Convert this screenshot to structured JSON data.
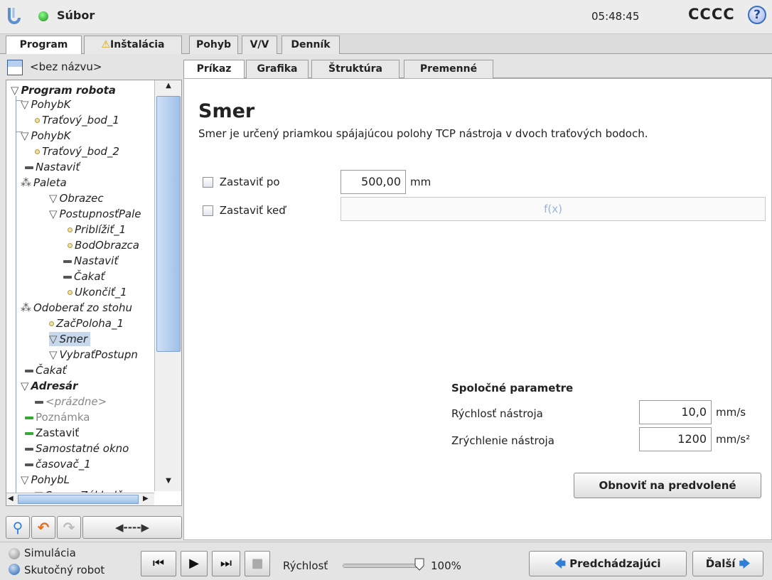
{
  "header": {
    "menu_label": "Súbor",
    "time": "05:48:45",
    "robot_name": "CCCC",
    "help_icon": "help-icon"
  },
  "main_tabs": [
    "Program",
    "Inštalácia",
    "Pohyb",
    "V/V",
    "Denník"
  ],
  "program_name": "<bez názvu>",
  "sub_tabs": [
    "Príkaz",
    "Grafika",
    "Štruktúra",
    "Premenné"
  ],
  "tree": [
    "Program robota",
    "PohybK",
    "Traťový_bod_1",
    "PohybK",
    "Traťový_bod_2",
    "Nastaviť",
    "Paleta",
    "Obrazec",
    "PostupnosťPale",
    "Priblížiť_1",
    "BodObrazca",
    "Nastaviť",
    "Čakať",
    "Ukončiť_1",
    "Odoberať zo stohu",
    "ZačPoloha_1",
    "Smer",
    "VybraťPostupn",
    "Čakať",
    "Adresár",
    "<prázdne>",
    "Poznámka",
    "Zastaviť",
    "Samostatné okno",
    "časovač_1",
    "PohybL",
    "Smer: Základň"
  ],
  "command": {
    "title": "Smer",
    "description": "Smer je určený priamkou spájajúcou polohy TCP nástroja v dvoch traťových bodoch.",
    "stop_after_label": "Zastaviť po",
    "stop_after_value": "500,00",
    "stop_after_unit": "mm",
    "stop_when_label": "Zastaviť keď",
    "stop_when_placeholder": "f(x)",
    "common_params_title": "Spoločné parametre",
    "tool_speed_label": "Rýchlosť nástroja",
    "tool_speed_value": "10,0",
    "tool_speed_unit": "mm/s",
    "tool_accel_label": "Zrýchlenie nástroja",
    "tool_accel_value": "1200",
    "tool_accel_unit": "mm/s²",
    "reset_button": "Obnoviť na predvolené"
  },
  "footer": {
    "simulation_label": "Simulácia",
    "real_robot_label": "Skutočný robot",
    "speed_label": "Rýchlosť",
    "speed_value": "100%",
    "speed_fraction": 1.0,
    "prev_button": "Predchádzajúci",
    "next_button": "Ďalší"
  },
  "colors": {
    "accent": "#2f7fd8",
    "selected": "#c8d8ec",
    "green_dot": "#2fa52f"
  }
}
